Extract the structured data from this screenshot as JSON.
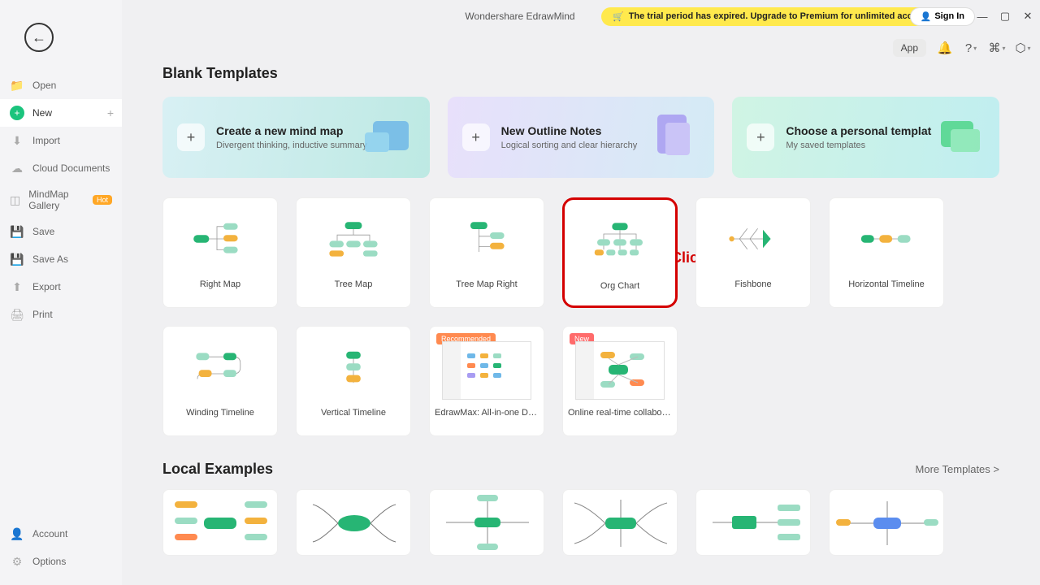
{
  "title": "Wondershare EdrawMind",
  "trial_banner": "The trial period has expired. Upgrade to Premium for unlimited access.",
  "signin": "Sign In",
  "toolbar": {
    "app": "App"
  },
  "sidebar": {
    "open": "Open",
    "new": "New",
    "import": "Import",
    "cloud": "Cloud Documents",
    "gallery": "MindMap Gallery",
    "gallery_badge": "Hot",
    "save": "Save",
    "saveas": "Save As",
    "export": "Export",
    "print": "Print",
    "account": "Account",
    "options": "Options"
  },
  "sections": {
    "blank": "Blank Templates",
    "local": "Local Examples",
    "more": "More Templates >"
  },
  "heroes": [
    {
      "title": "Create a new mind map",
      "sub": "Divergent thinking, inductive summary"
    },
    {
      "title": "New Outline Notes",
      "sub": "Logical sorting and clear hierarchy"
    },
    {
      "title": "Choose a personal templat",
      "sub": "My saved templates"
    }
  ],
  "templates": {
    "right_map": "Right Map",
    "tree_map": "Tree Map",
    "tree_map_right": "Tree Map Right",
    "org_chart": "Org Chart",
    "fishbone": "Fishbone",
    "horiz_timeline": "Horizontal Timeline",
    "winding_timeline": "Winding Timeline",
    "vertical_timeline": "Vertical Timeline",
    "edrawmax": "EdrawMax: All-in-one Dia...",
    "online_collab": "Online real-time collabora...",
    "badge_rec": "Recommended",
    "badge_new": "New"
  },
  "annotation": "Click Org Chart"
}
